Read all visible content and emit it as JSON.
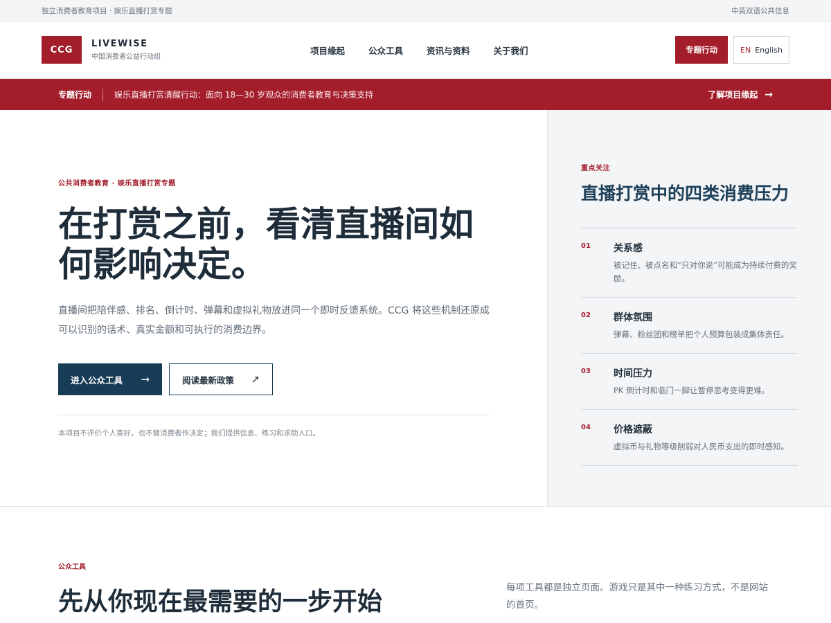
{
  "utility": {
    "left": "独立消费者教育项目 · 娱乐直播打赏专题",
    "right": "中英双语公共信息"
  },
  "header": {
    "logo": "CCG",
    "brand_name": "LIVEWISE",
    "brand_sub": "中国消费者公益行动组",
    "nav": [
      "项目缘起",
      "公众工具",
      "资讯与资料",
      "关于我们"
    ],
    "action_label": "专题行动",
    "lang_code": "EN",
    "lang_label": "English"
  },
  "banner": {
    "tag": "专题行动",
    "message": "娱乐直播打赏清醒行动：面向 18—30 岁观众的消费者教育与决策支持",
    "more": "了解项目缘起",
    "more_arrow": "→"
  },
  "hero": {
    "eyebrow": "公共消费者教育 · 娱乐直播打赏专题",
    "title": "在打赏之前，看清直播间如何影响决定。",
    "description": "直播间把陪伴感、排名、倒计时、弹幕和虚拟礼物放进同一个即时反馈系统。CCG 将这些机制还原成可以识别的话术、真实金额和可执行的消费边界。",
    "cta_primary": "进入公众工具",
    "cta_primary_arrow": "→",
    "cta_secondary": "阅读最新政策",
    "cta_secondary_arrow": "↗",
    "note": "本项目不评价个人喜好，也不替消费者作决定；我们提供信息、练习和求助入口。"
  },
  "focus": {
    "eyebrow": "重点关注",
    "title": "直播打赏中的四类消费压力",
    "items": [
      {
        "num": "01",
        "head": "关系感",
        "text": "被记住、被点名和“只对你说”可能成为持续付费的奖励。"
      },
      {
        "num": "02",
        "head": "群体氛围",
        "text": "弹幕、粉丝团和榜单把个人预算包装成集体责任。"
      },
      {
        "num": "03",
        "head": "时间压力",
        "text": "PK 倒计时和临门一脚让暂停思考变得更难。"
      },
      {
        "num": "04",
        "head": "价格遮蔽",
        "text": "虚拟币与礼物等级削弱对人民币支出的即时感知。"
      }
    ]
  },
  "tools": {
    "eyebrow": "公众工具",
    "title": "先从你现在最需要的一步开始",
    "description": "每项工具都是独立页面。游戏只是其中一种练习方式，不是网站的首页。"
  },
  "colors": {
    "brand_red": "#a31d2b",
    "navy": "#173c55"
  }
}
